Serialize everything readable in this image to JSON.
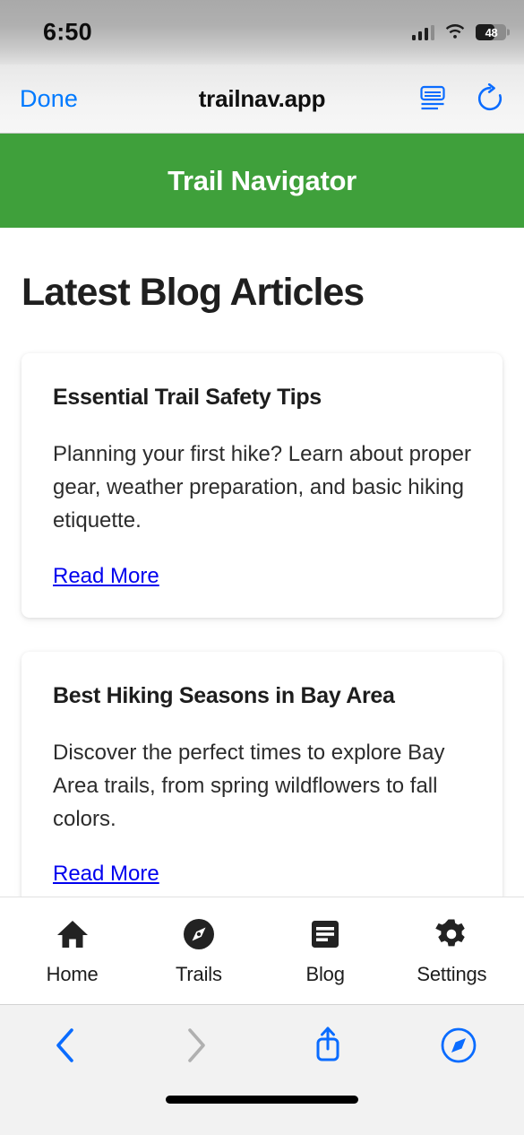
{
  "status_bar": {
    "time": "6:50",
    "battery_level": "48",
    "signal_icon": "cellular-signal-icon",
    "wifi_icon": "wifi-icon",
    "battery_icon": "battery-icon"
  },
  "browser": {
    "done_label": "Done",
    "url_title": "trailnav.app",
    "reader_icon": "reader-view-icon",
    "reload_icon": "reload-icon",
    "accent_color": "#007aff"
  },
  "site": {
    "header_title": "Trail Navigator",
    "header_color": "#3fa03b",
    "page_title": "Latest Blog Articles",
    "articles": [
      {
        "title": "Essential Trail Safety Tips",
        "excerpt": "Planning your first hike? Learn about proper gear, weather preparation, and basic hiking etiquette.",
        "link_label": "Read More",
        "link_color": "#0000ee"
      },
      {
        "title": "Best Hiking Seasons in Bay Area",
        "excerpt": "Discover the perfect times to explore Bay Area trails, from spring wildflowers to fall colors.",
        "link_label": "Read More",
        "link_color": "#0000ee"
      }
    ],
    "tabs": [
      {
        "label": "Home",
        "icon": "home-icon"
      },
      {
        "label": "Trails",
        "icon": "compass-icon"
      },
      {
        "label": "Blog",
        "icon": "article-icon"
      },
      {
        "label": "Settings",
        "icon": "gear-icon"
      }
    ]
  },
  "toolbar": {
    "back_icon": "chevron-left-icon",
    "forward_icon": "chevron-right-icon",
    "share_icon": "share-icon",
    "safari_icon": "safari-compass-icon",
    "back_enabled_color": "#0a6cff",
    "forward_disabled_color": "#b0b0b0"
  }
}
